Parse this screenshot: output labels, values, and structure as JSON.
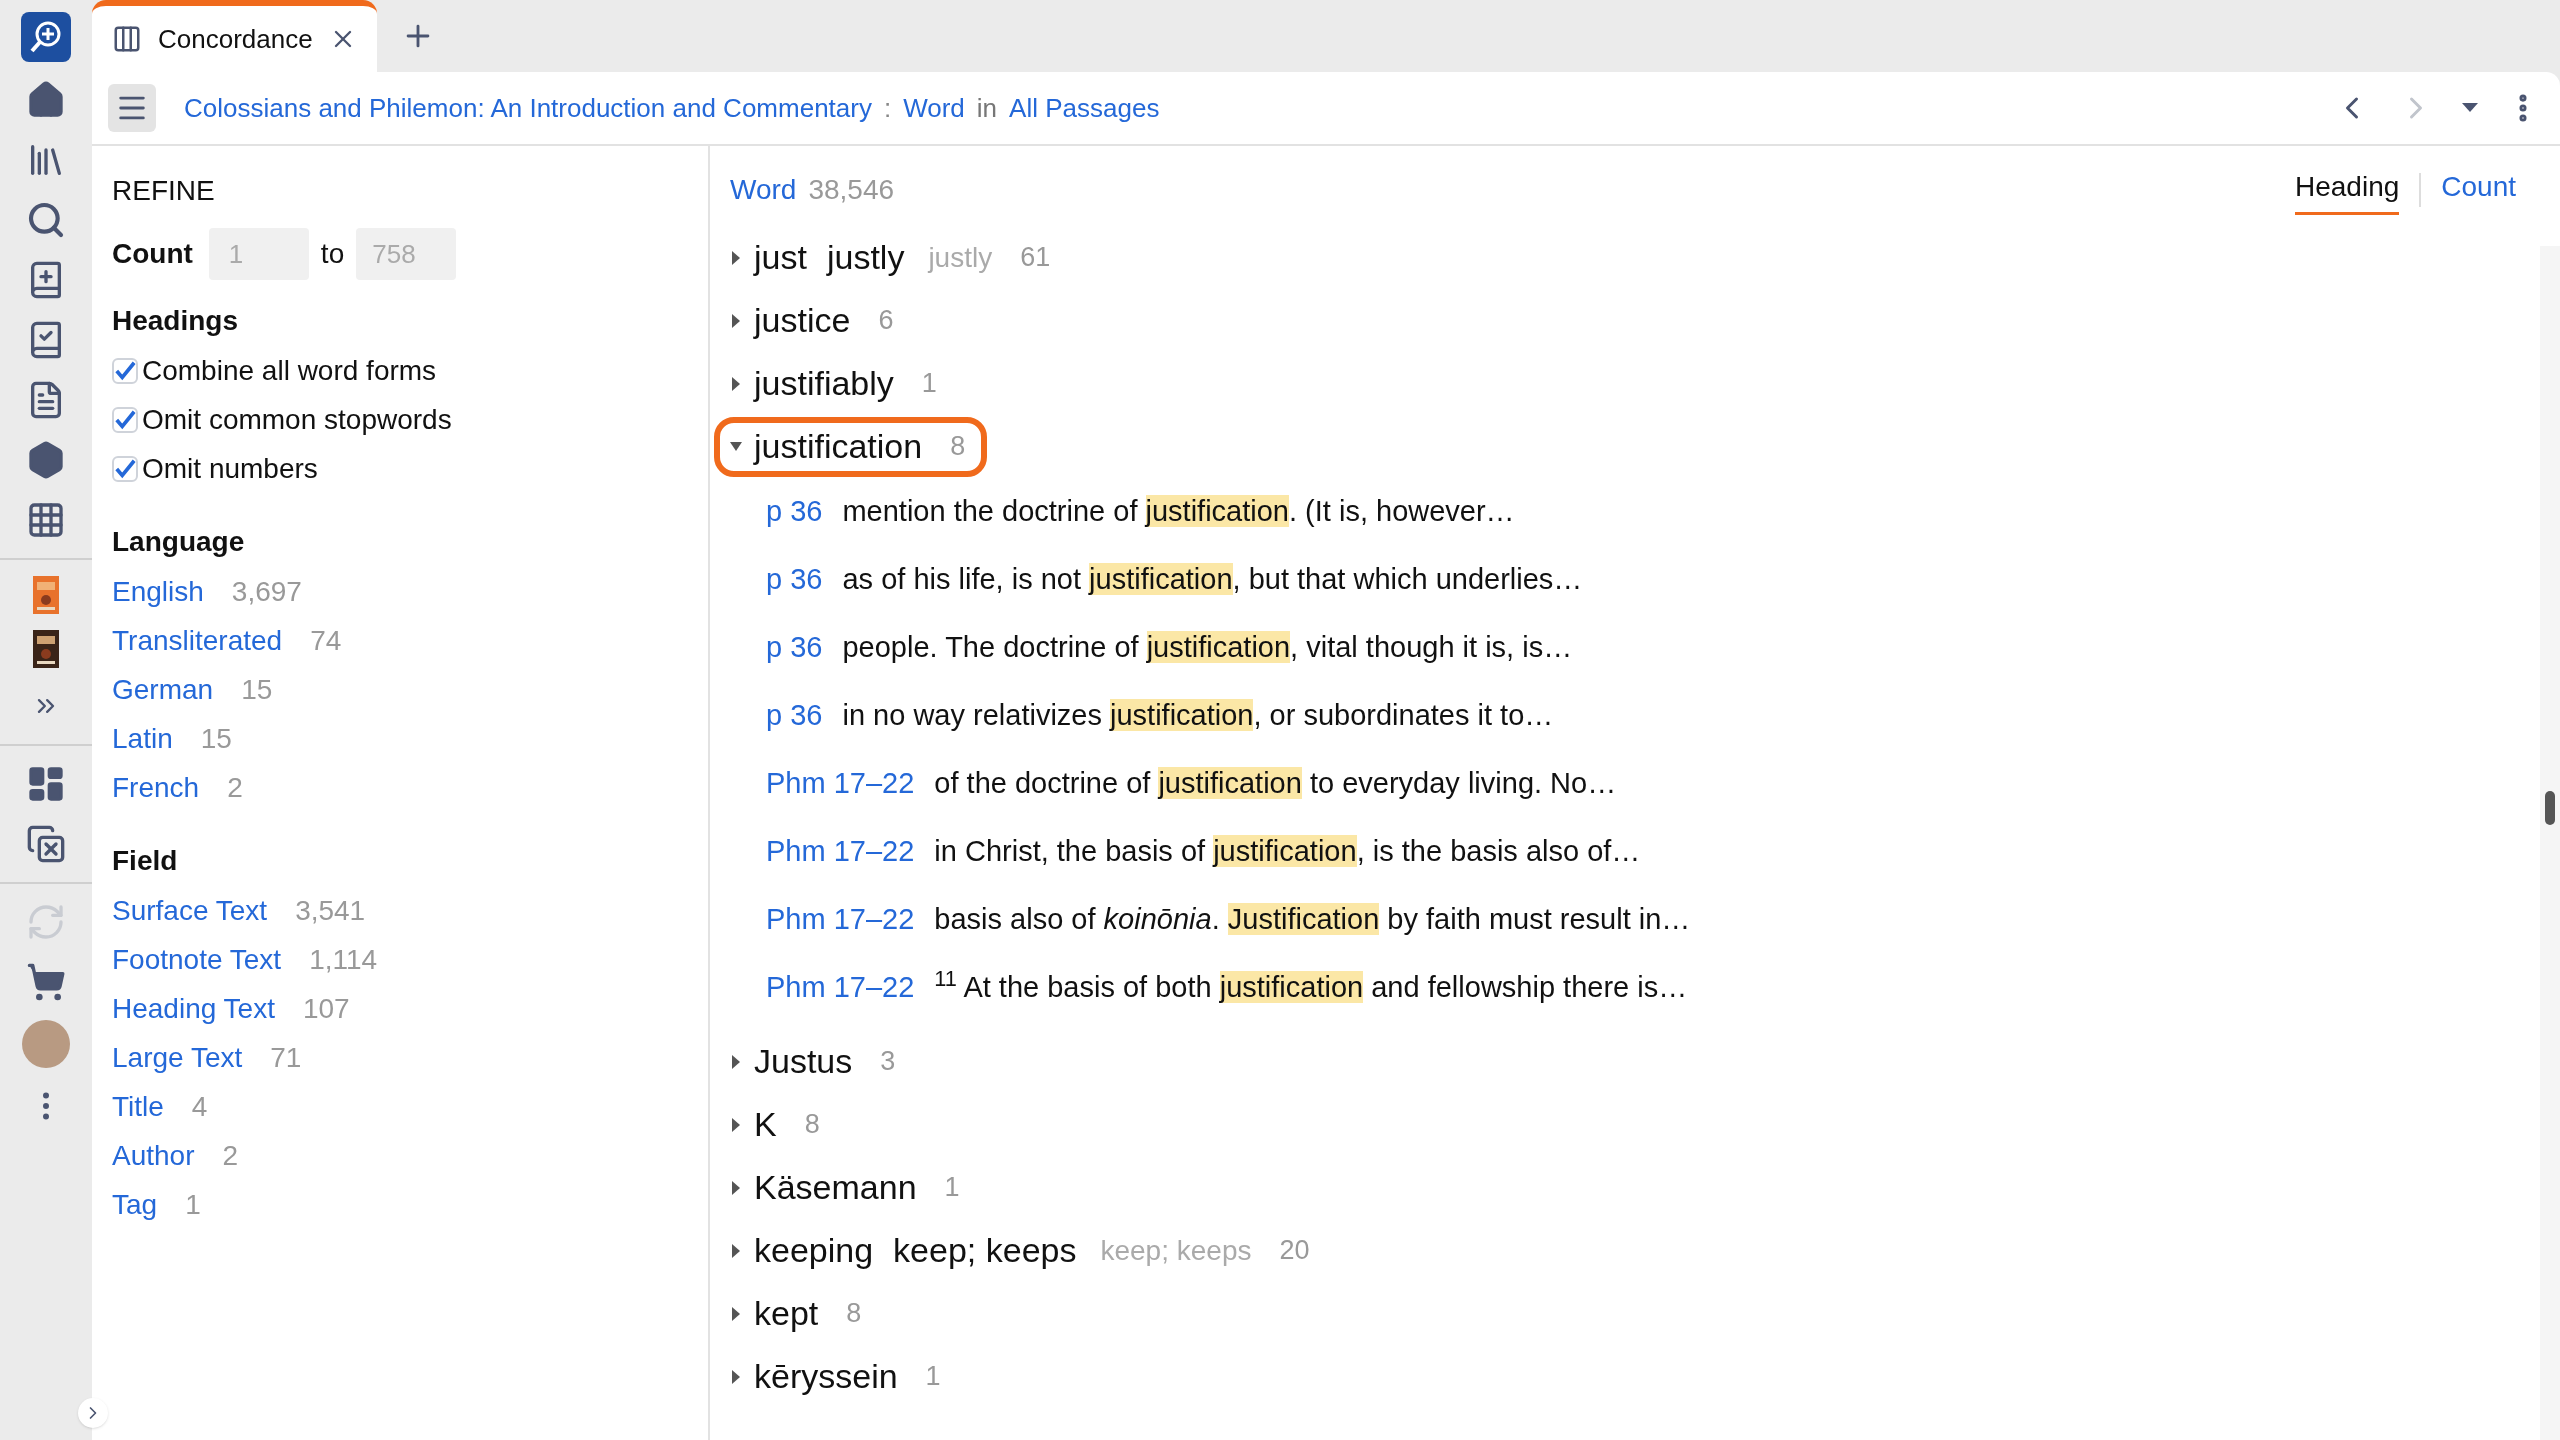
{
  "tabs": [
    {
      "label": "Concordance",
      "selected": true
    }
  ],
  "breadcrumb": {
    "resource": "Colossians and Philemon: An Introduction and Commentary",
    "separator": ":",
    "field": "Word",
    "connector": "in",
    "range": "All Passages"
  },
  "nav": {
    "back_disabled": false,
    "forward_disabled": true
  },
  "refine": {
    "title": "REFINE",
    "count": {
      "label": "Count",
      "from_placeholder": "1",
      "connector": "to",
      "to_placeholder": "758"
    },
    "headings": {
      "title": "Headings",
      "options": [
        {
          "label": "Combine all word forms",
          "checked": true
        },
        {
          "label": "Omit common stopwords",
          "checked": true
        },
        {
          "label": "Omit numbers",
          "checked": true
        }
      ]
    },
    "groups": [
      {
        "title": "Language",
        "items": [
          {
            "label": "English",
            "count": "3,697"
          },
          {
            "label": "Transliterated",
            "count": "74"
          },
          {
            "label": "German",
            "count": "15"
          },
          {
            "label": "Latin",
            "count": "15"
          },
          {
            "label": "French",
            "count": "2"
          }
        ]
      },
      {
        "title": "Field",
        "items": [
          {
            "label": "Surface Text",
            "count": "3,541"
          },
          {
            "label": "Footnote Text",
            "count": "1,114"
          },
          {
            "label": "Heading Text",
            "count": "107"
          },
          {
            "label": "Large Text",
            "count": "71"
          },
          {
            "label": "Title",
            "count": "4"
          },
          {
            "label": "Author",
            "count": "2"
          },
          {
            "label": "Tag",
            "count": "1"
          }
        ]
      }
    ]
  },
  "results": {
    "heading": "Word",
    "total": "38,546",
    "sort": [
      {
        "label": "Heading",
        "selected": true
      },
      {
        "label": "Count",
        "selected": false
      }
    ],
    "entries": [
      {
        "word": "just",
        "forms": "justly",
        "forms_dim": "justly",
        "count": "61",
        "expanded": false,
        "circled": false
      },
      {
        "word": "justice",
        "count": "6",
        "expanded": false,
        "circled": false
      },
      {
        "word": "justifiably",
        "count": "1",
        "expanded": false,
        "circled": false
      },
      {
        "word": "justification",
        "count": "8",
        "expanded": true,
        "circled": true,
        "hits": [
          {
            "ref": "p 36",
            "before": "mention the doctrine of ",
            "match": "justification",
            "after": ". (It is, however…"
          },
          {
            "ref": "p 36",
            "before": "as of his life, is not ",
            "match": "justification",
            "after": ", but that which underlies…"
          },
          {
            "ref": "p 36",
            "before": "people. The doctrine of ",
            "match": "justification",
            "after": ", vital though it is, is…"
          },
          {
            "ref": "p 36",
            "before": "in no way relativizes ",
            "match": "justification",
            "after": ", or subordinates it to…"
          },
          {
            "ref": "Phm 17–22",
            "before": "of the doctrine of ",
            "match": "justification",
            "after": " to everyday living. No…"
          },
          {
            "ref": "Phm 17–22",
            "before": "in Christ, the basis of ",
            "match": "justification",
            "after": ", is the basis also of…"
          },
          {
            "ref": "Phm 17–22",
            "before": "basis also of *koinōnia*. ",
            "match": "Justification",
            "after": " by faith must result in…"
          },
          {
            "ref": "Phm 17–22",
            "before": "$^{11}$ At the basis of both ",
            "match": "justification",
            "after": " and fellowship there is…"
          }
        ]
      },
      {
        "word": "Justus",
        "count": "3",
        "expanded": false,
        "circled": false
      },
      {
        "word": "K",
        "count": "8",
        "expanded": false,
        "circled": false
      },
      {
        "word": "Käsemann",
        "count": "1",
        "expanded": false,
        "circled": false
      },
      {
        "word": "keeping",
        "forms": "keep; keeps",
        "forms_dim": "keep; keeps",
        "count": "20",
        "expanded": false,
        "circled": false
      },
      {
        "word": "kept",
        "count": "8",
        "expanded": false,
        "circled": false
      },
      {
        "word": "kēryssein",
        "count": "1",
        "expanded": false,
        "circled": false
      }
    ]
  }
}
